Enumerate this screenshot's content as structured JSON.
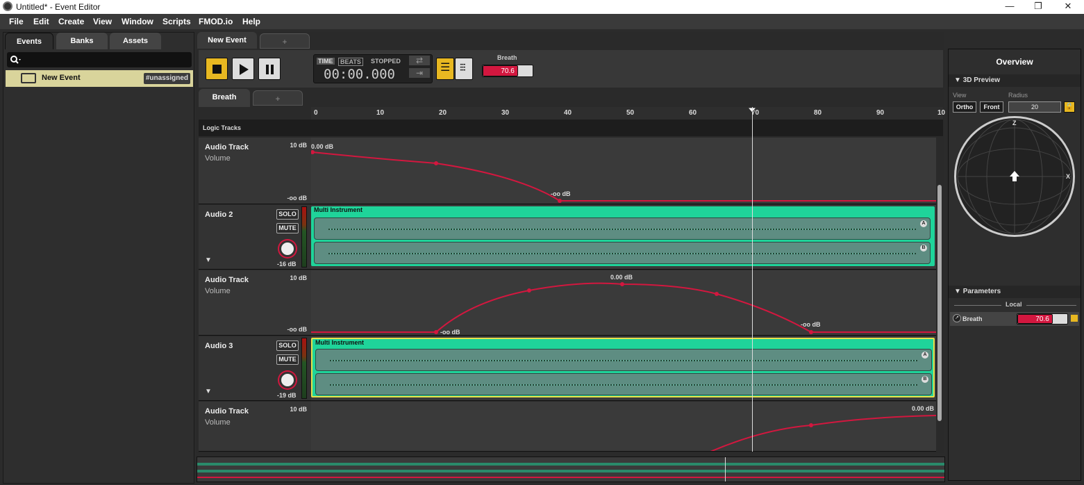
{
  "window": {
    "title": "Untitled* - Event Editor",
    "minimize": "—",
    "maximize": "❐",
    "close": "✕"
  },
  "menu": [
    "File",
    "Edit",
    "Create",
    "View",
    "Window",
    "Scripts",
    "FMOD.io",
    "Help"
  ],
  "left": {
    "tabs": [
      "Events",
      "Banks",
      "Assets"
    ],
    "event": {
      "name": "New Event",
      "tag": "#unassigned"
    }
  },
  "editor": {
    "tab": "New Event",
    "add_tab": "+",
    "timer": {
      "mode_time": "TIME",
      "mode_beats": "BEATS",
      "state": "STOPPED",
      "value": "00:00.000"
    },
    "param": {
      "label": "Breath",
      "value": "70.6",
      "fraction": 0.706
    },
    "param_tab": "Breath",
    "param_add": "+",
    "ruler": [
      "0",
      "10",
      "20",
      "30",
      "40",
      "50",
      "60",
      "70",
      "80",
      "90",
      "10"
    ],
    "logic_label": "Logic Tracks",
    "tracks": [
      {
        "name": "Audio Track",
        "sub": "Volume",
        "top_db": "10 dB",
        "bottom_db": "-oo dB",
        "labels": [
          "0.00 dB",
          "-oo dB"
        ]
      },
      {
        "name": "Audio 2",
        "solo": "SOLO",
        "mute": "MUTE",
        "level": "-16 dB",
        "instrument": "Multi Instrument"
      },
      {
        "name": "Audio Track",
        "sub": "Volume",
        "top_db": "10 dB",
        "bottom_db": "-oo dB",
        "labels": [
          "0.00 dB",
          "-oo dB",
          "-oo dB"
        ]
      },
      {
        "name": "Audio 3",
        "solo": "SOLO",
        "mute": "MUTE",
        "level": "-19 dB",
        "instrument": "Multi Instrument"
      },
      {
        "name": "Audio Track",
        "sub": "Volume",
        "top_db": "10 dB",
        "labels": [
          "0.00 dB"
        ]
      }
    ],
    "wave_badges": [
      "A",
      "B"
    ]
  },
  "right": {
    "overview": "Overview",
    "preview": "3D Preview",
    "view_label": "View",
    "radius_label": "Radius",
    "ortho": "Ortho",
    "front": "Front",
    "radius": "20",
    "axis_z": "Z",
    "axis_x": "X",
    "parameters": "Parameters",
    "local": "Local",
    "param_name": "Breath",
    "param_value": "70.6"
  },
  "colors": {
    "accent": "#d3173f",
    "instrument": "#1fd49a",
    "yellow": "#e8b821",
    "selected": "#d9d49b"
  }
}
